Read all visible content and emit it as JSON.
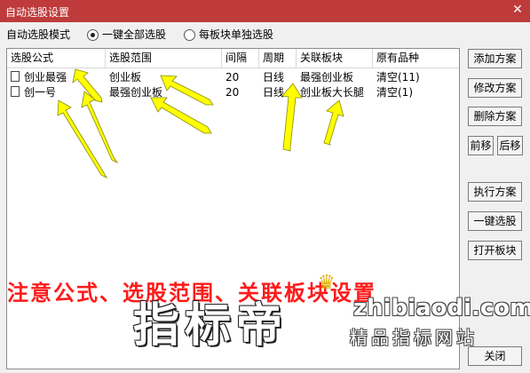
{
  "window": {
    "title": "自动选股设置",
    "close_glyph": "✕"
  },
  "mode": {
    "label": "自动选股模式",
    "options": [
      {
        "label": "一键全部选股",
        "selected": true
      },
      {
        "label": "每板块单独选股",
        "selected": false
      }
    ]
  },
  "table": {
    "columns": [
      "选股公式",
      "选股范围",
      "间隔",
      "周期",
      "关联板块",
      "原有品种"
    ],
    "rows": [
      {
        "formula": "创业最强",
        "scope": "创业板",
        "interval": "20",
        "period": "日线",
        "board": "最强创业板",
        "original": "清空(11)"
      },
      {
        "formula": "创一号",
        "scope": "最强创业板",
        "interval": "20",
        "period": "日线",
        "board": "创业板大长腿",
        "original": "清空(1)"
      }
    ]
  },
  "buttons": {
    "add": "添加方案",
    "edit": "修改方案",
    "delete": "删除方案",
    "move_up": "前移",
    "move_down": "后移",
    "execute": "执行方案",
    "one_click": "一键选股",
    "open_board": "打开板块",
    "close": "关闭"
  },
  "overlay": {
    "note": "注意公式、选股范围、关联板块设置",
    "brand": "指标帝",
    "url": "zhibiaodi.com",
    "tagline": "精品指标网站"
  },
  "colors": {
    "titlebar": "#bf3b3b",
    "arrow": "#ffff00",
    "note": "#ff1a1a"
  }
}
